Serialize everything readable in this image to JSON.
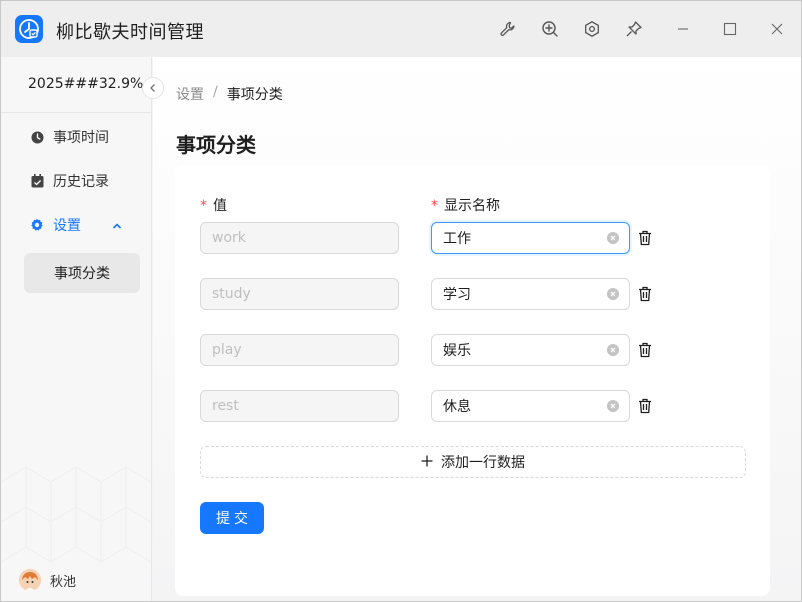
{
  "app": {
    "title": "柳比歇夫时间管理"
  },
  "sidebar": {
    "header_text": "2025###32.9%",
    "items": [
      {
        "label": "事项时间",
        "icon": "clock-icon"
      },
      {
        "label": "历史记录",
        "icon": "calendar-icon"
      },
      {
        "label": "设置",
        "icon": "gear-icon"
      }
    ],
    "sub_item": "事项分类",
    "user": "秋池"
  },
  "breadcrumb": {
    "parent": "设置",
    "separator": "/",
    "current": "事项分类"
  },
  "page": {
    "title": "事项分类"
  },
  "form": {
    "col_value_label": "值",
    "col_name_label": "显示名称",
    "required_mark": "*",
    "rows": [
      {
        "value": "work",
        "name": "工作"
      },
      {
        "value": "study",
        "name": "学习"
      },
      {
        "value": "play",
        "name": "娱乐"
      },
      {
        "value": "rest",
        "name": "休息"
      }
    ],
    "add_row_label": "添加一行数据",
    "submit_label": "提交"
  },
  "colors": {
    "accent": "#1677ff",
    "required": "#ff4d4f"
  }
}
